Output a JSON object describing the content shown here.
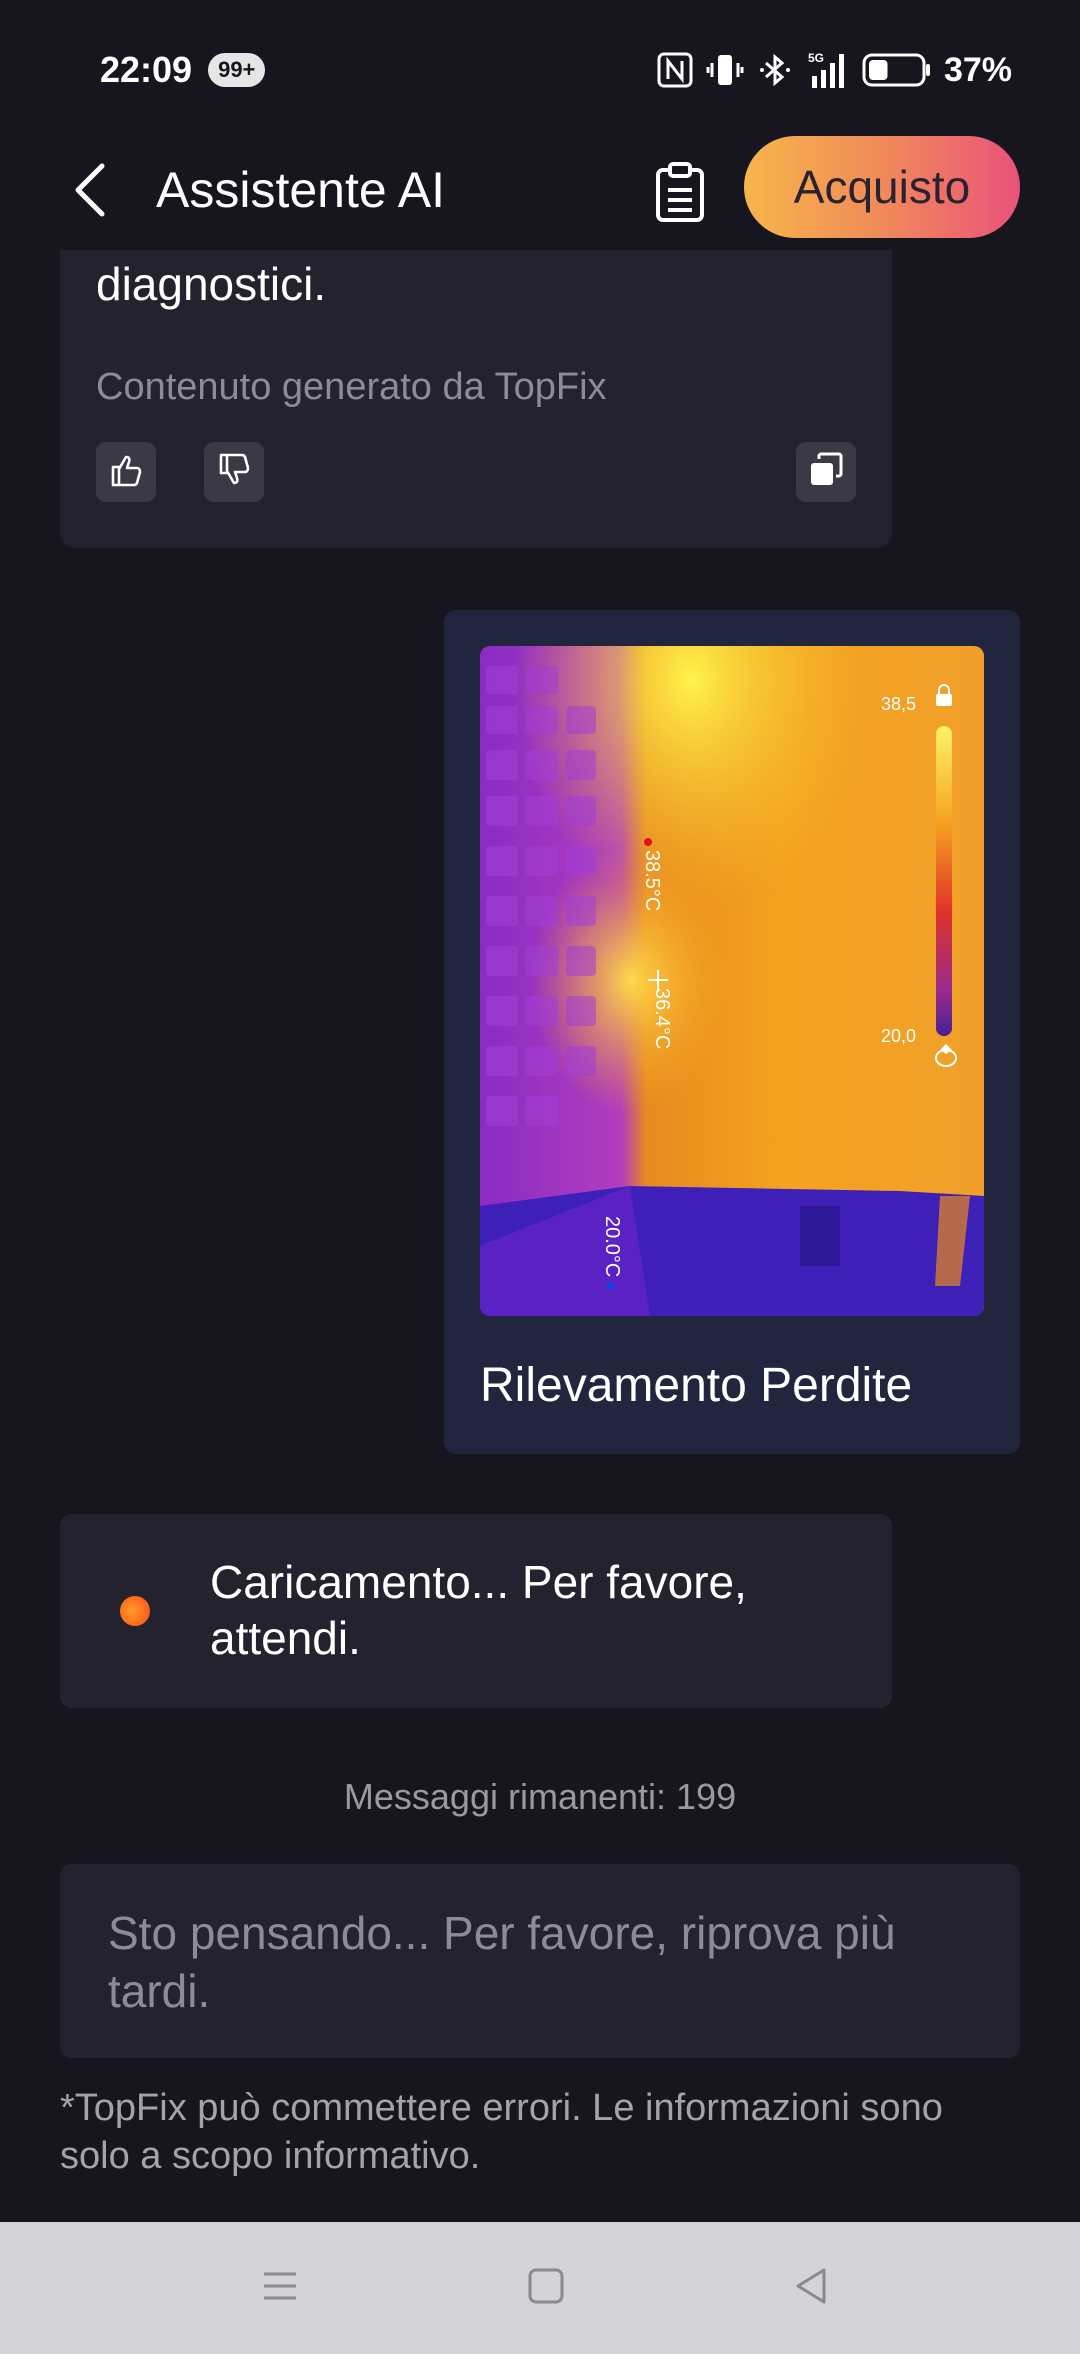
{
  "status_bar": {
    "time": "22:09",
    "badge": "99+",
    "network": "5G",
    "battery": "37%",
    "battery_level": 0.37
  },
  "header": {
    "title": "Assistente AI",
    "buy_label": "Acquisto"
  },
  "ai_message": {
    "text": "diagnostici.",
    "generated_by": "Contenuto generato da TopFix"
  },
  "image_message": {
    "caption": "Rilevamento Perdite",
    "thermal": {
      "spot_max": "38.5°C",
      "spot_center": "36.4°C",
      "spot_min": "20.0°C",
      "scale_max": "38,5",
      "scale_min": "20,0"
    }
  },
  "loading": {
    "text": "Caricamento... Per favore, attendi."
  },
  "remaining_messages": "Messaggi rimanenti: 199",
  "input": {
    "placeholder": "Sto pensando... Per favore, riprova più tardi."
  },
  "disclaimer": "*TopFix  può commettere errori. Le informazioni sono solo a scopo informativo.",
  "colors": {
    "background": "#17161f",
    "card": "#23222e",
    "image_bubble": "#21253d",
    "accent_start": "#f7b54a",
    "accent_end": "#e9527a"
  }
}
